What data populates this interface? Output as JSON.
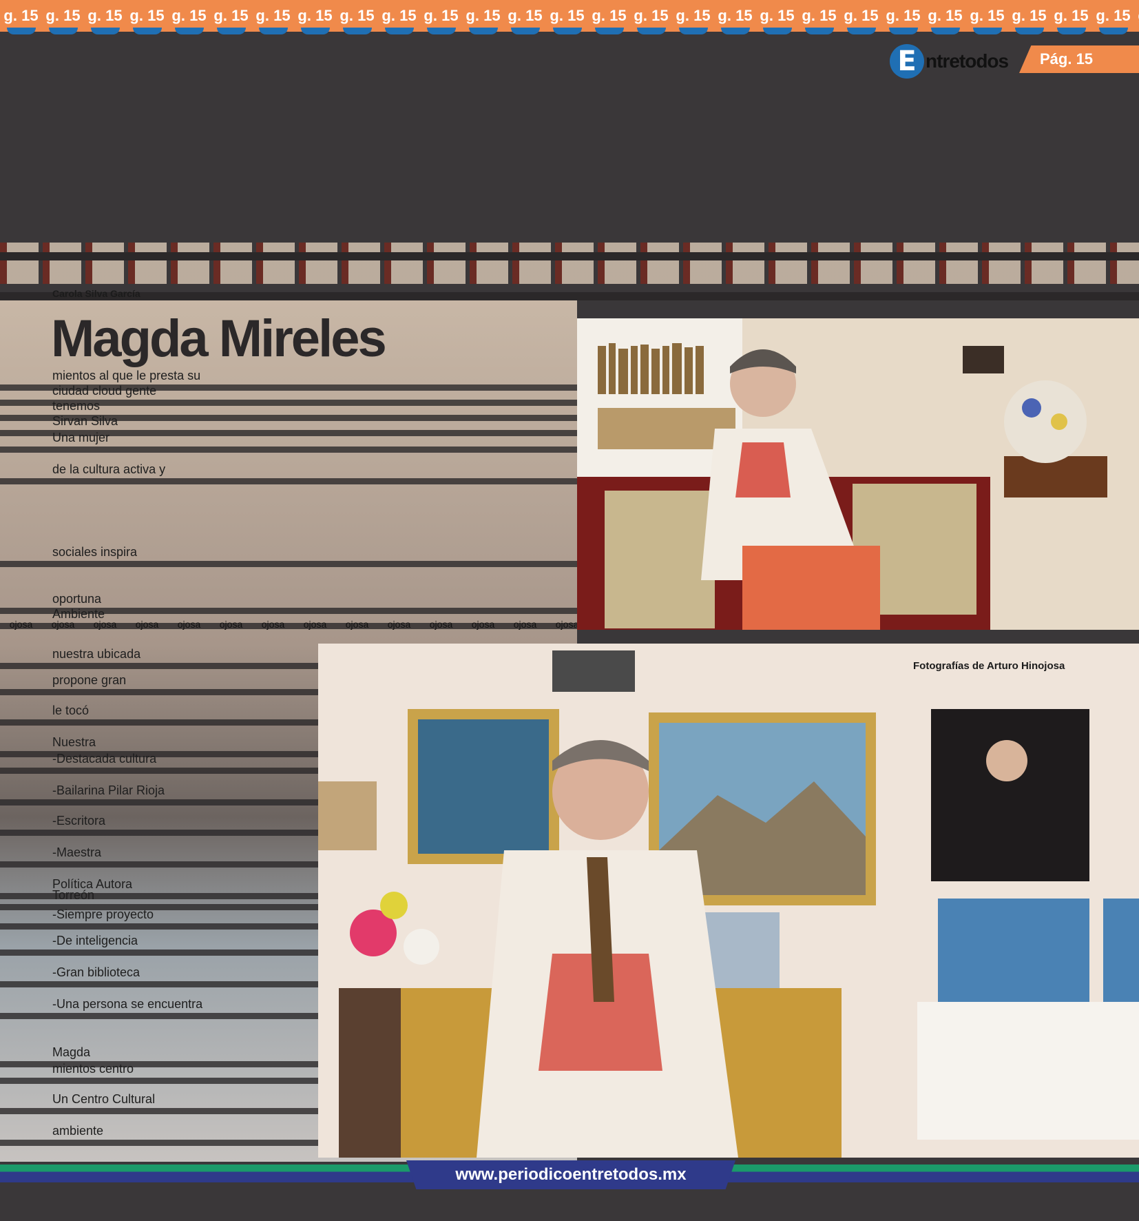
{
  "header": {
    "page_number_label": "g. 15",
    "page_tag": "Pág. 15",
    "logo_letter": "E",
    "logo_text": "ntretodos"
  },
  "article": {
    "byline": "Carola Silva García",
    "headline": "Magda Mireles",
    "paragraphs": [
      "mientos al que le presta su",
      "ciudad cloud gente",
      "tenemos",
      "Sirvan Silva",
      "Una mujer",
      "de la cultura activa y",
      "sociales inspira",
      "oportuna",
      "Ambiente",
      "nuestra ubicada",
      "propone gran",
      "le tocó",
      "Nuestra",
      "-Destacada cultura",
      "-Bailarina Pilar Rioja",
      "-Escritora",
      "-Maestra",
      "Política Autora",
      "Torreón",
      "-Siempre proyecto",
      "-De inteligencia",
      "-Gran biblioteca",
      "-Una persona se encuentra",
      "Magda",
      "mientos centro",
      "Un Centro Cultural",
      "ambiente"
    ]
  },
  "photos": {
    "caption": "Fotografías de Arturo Hinojosa",
    "caption_repeat": "ojosa"
  },
  "footer": {
    "url": "www.periodicoentretodos.mx"
  },
  "colors": {
    "accent_orange": "#f08a4b",
    "brand_blue": "#1f6fb4",
    "footer_blue": "#2f3a8a",
    "footer_green": "#1b9a6a"
  }
}
